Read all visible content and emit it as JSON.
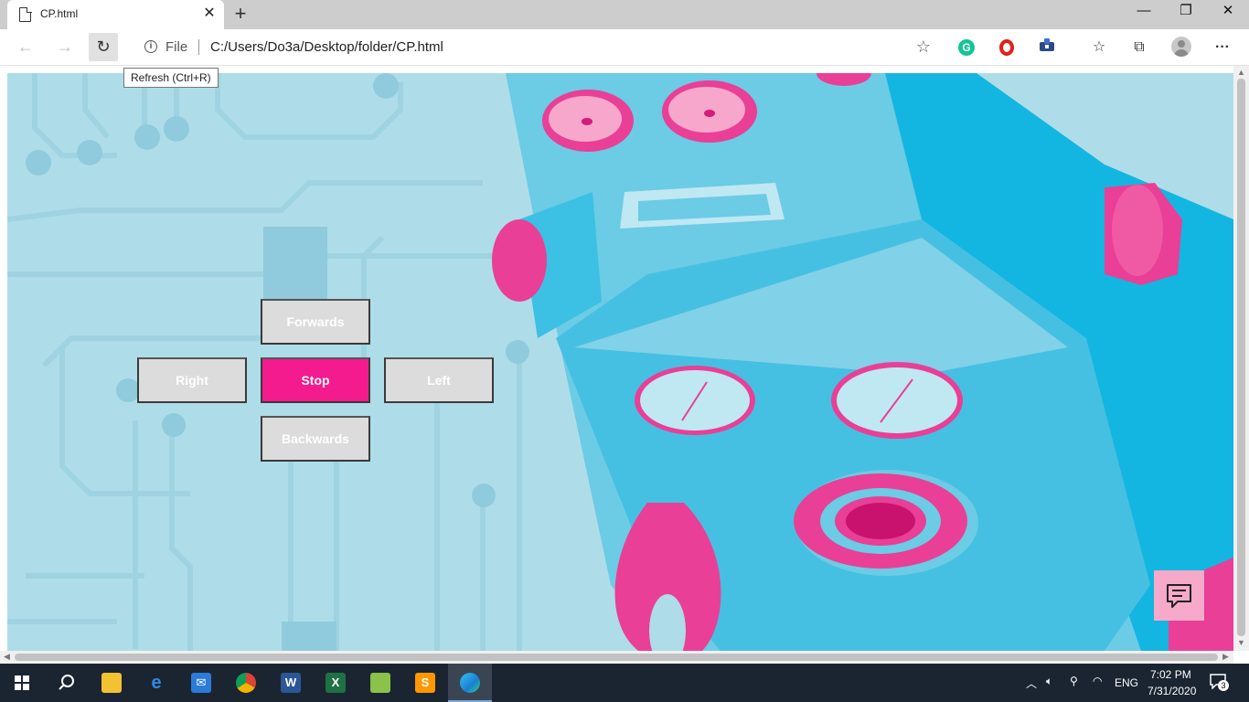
{
  "browser": {
    "tab_title": "CP.html",
    "tab_close": "✕",
    "new_tab": "+",
    "window_minimize": "—",
    "window_restore": "❐",
    "window_close": "✕",
    "back": "←",
    "forward": "→",
    "refresh": "↻",
    "address_scheme_label": "File",
    "address_url": "C:/Users/Do3a/Desktop/folder/CP.html",
    "favorite_star": "☆",
    "grammarly_letter": "G",
    "favorites_glyph": "☆",
    "collections_glyph": "⧉",
    "menu_glyph": "···",
    "refresh_tooltip": "Refresh (Ctrl+R)"
  },
  "controls": {
    "forwards_label": "Forwards",
    "right_label": "Right",
    "stop_label": "Stop",
    "left_label": "Left",
    "backwards_label": "Backwards"
  },
  "colors": {
    "stop_button": "#f31b8d",
    "direction_button": "#dcdcdc",
    "background_light": "#aedde9",
    "robot_cyan": "#13b6e0",
    "robot_pink": "#e93f96"
  },
  "taskbar": {
    "apps": [
      "start-icon",
      "search-icon",
      "file-explorer-icon",
      "edge-legacy-icon",
      "mail-icon",
      "chrome-icon",
      "word-icon",
      "excel-icon",
      "notepad-icon",
      "sublime-text-icon",
      "edge-icon"
    ],
    "language": "ENG",
    "time": "7:02 PM",
    "date": "7/31/2020",
    "notification_count": "3"
  }
}
